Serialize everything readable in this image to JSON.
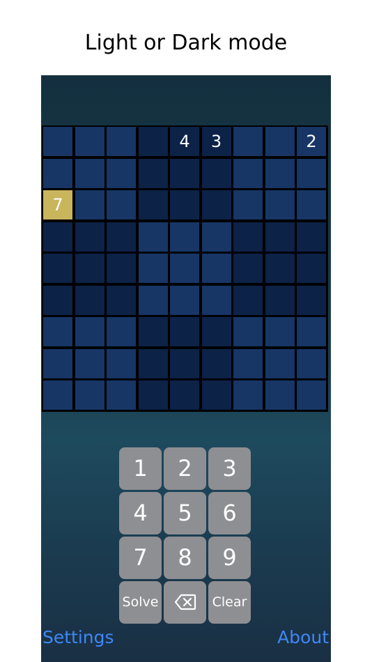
{
  "caption": "Light or Dark mode",
  "grid": {
    "givens": [
      {
        "row": 0,
        "col": 4,
        "value": "4"
      },
      {
        "row": 0,
        "col": 5,
        "value": "3"
      },
      {
        "row": 0,
        "col": 8,
        "value": "2"
      },
      {
        "row": 2,
        "col": 0,
        "value": "7"
      }
    ],
    "selected": {
      "row": 2,
      "col": 0
    }
  },
  "keypad": {
    "keys": [
      "1",
      "2",
      "3",
      "4",
      "5",
      "6",
      "7",
      "8",
      "9"
    ],
    "solve_label": "Solve",
    "clear_label": "Clear",
    "backspace_icon": "delete-left-icon"
  },
  "footer": {
    "settings_label": "Settings",
    "about_label": "About"
  },
  "colors": {
    "accent": "#3f88f5",
    "cell_light": "#173666",
    "cell_dark": "#0c2247",
    "cell_selected": "#c9b55c",
    "key_bg": "#8e8f93"
  }
}
